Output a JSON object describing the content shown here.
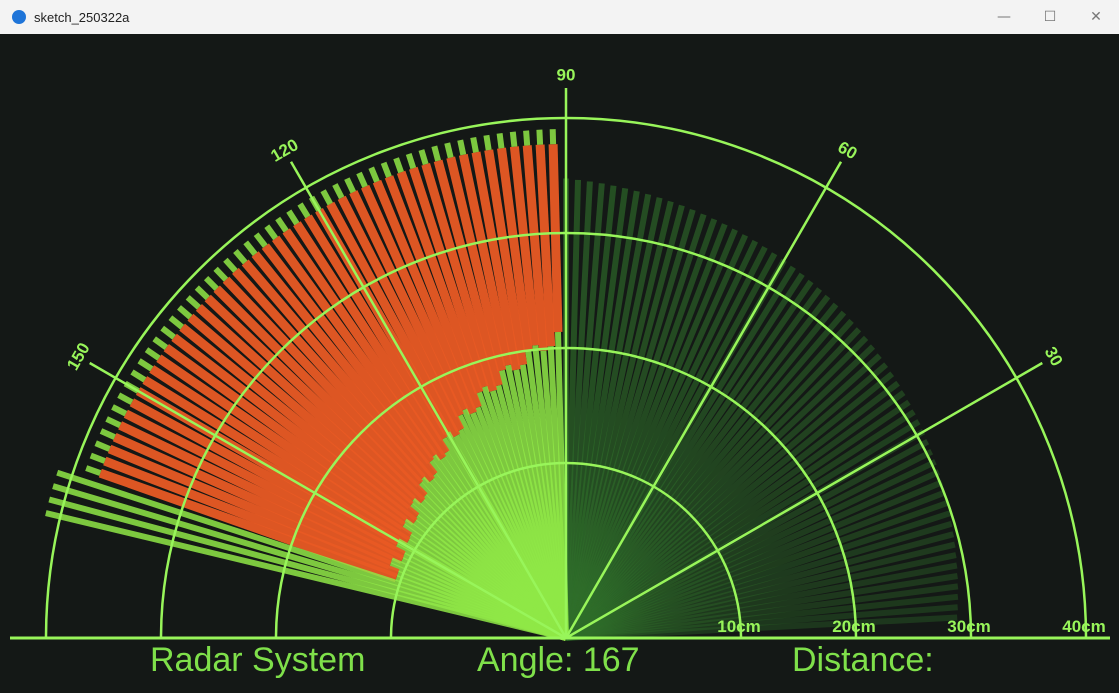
{
  "window": {
    "title": "sketch_250322a",
    "controls": {
      "minimize": "—",
      "maximize": "☐",
      "close": "✕"
    }
  },
  "radar": {
    "angle_labels": [
      "30",
      "60",
      "90",
      "120",
      "150"
    ],
    "range_labels": [
      "10cm",
      "20cm",
      "30cm",
      "40cm"
    ],
    "sweep_angle_deg": 167,
    "colors": {
      "grid": "#98f55a",
      "detected": "#e85a24",
      "free_bright": "#8fe846",
      "free_dim": "#2f6e2a"
    }
  },
  "footer": {
    "title": "Radar System",
    "angle_text": "Angle: 167",
    "distance_text": "Distance:"
  }
}
